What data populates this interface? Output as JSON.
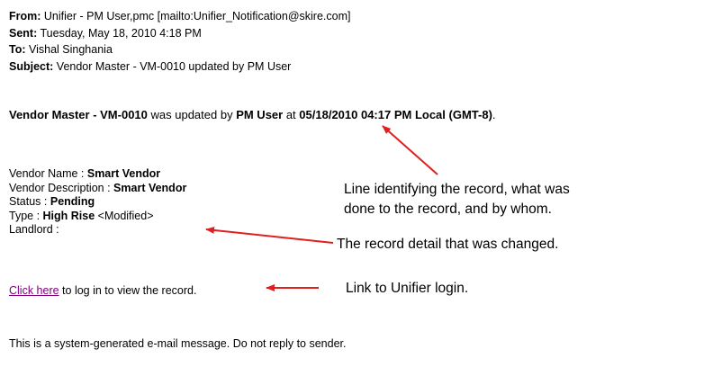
{
  "email": {
    "from_label": "From:",
    "from_value": "Unifier - PM User,pmc [mailto:Unifier_Notification@skire.com]",
    "sent_label": "Sent:",
    "sent_value": "Tuesday, May 18, 2010 4:18 PM",
    "to_label": "To:",
    "to_value": "Vishal Singhania",
    "subject_label": "Subject:",
    "subject_value": "Vendor Master - VM-0010 updated by PM User"
  },
  "summary": {
    "record_name": "Vendor Master - VM-0010",
    "text1": " was updated by ",
    "user": "PM User",
    "text2": " at ",
    "timestamp": "05/18/2010 04:17 PM Local (GMT-8)",
    "end": "."
  },
  "details": {
    "vendor_name_label": "Vendor Name : ",
    "vendor_name_value": "Smart Vendor",
    "vendor_desc_label": "Vendor Description : ",
    "vendor_desc_value": "Smart Vendor",
    "status_label": "Status : ",
    "status_value": "Pending",
    "type_label": "Type : ",
    "type_value": "High Rise",
    "type_modified": " <Modified>",
    "landlord_label": "Landlord :"
  },
  "link": {
    "link_text": "Click here",
    "after_text": " to log in to view the record."
  },
  "footer": "This is a system-generated e-mail message. Do not reply to sender.",
  "annotations": {
    "line1": "Line identifying the record, what was",
    "line2": "done to the record, and by whom.",
    "changed": "The record detail that was changed.",
    "login": "Link to Unifier login."
  },
  "colors": {
    "arrow": "#e02020",
    "link": "#800080"
  }
}
